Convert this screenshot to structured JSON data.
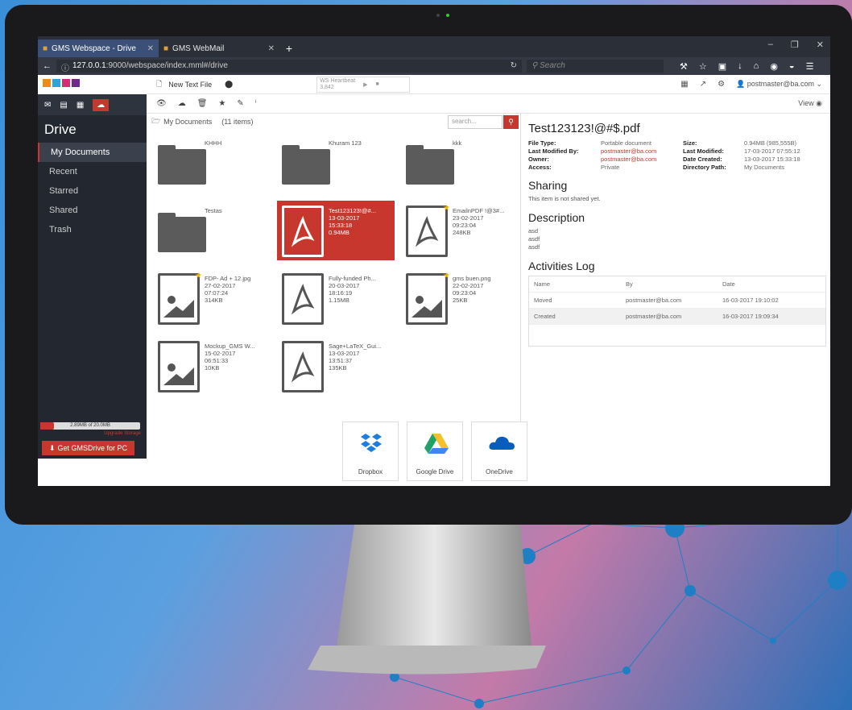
{
  "browser": {
    "tabs": [
      {
        "label": "GMS Webspace - Drive",
        "active": true
      },
      {
        "label": "GMS WebMail",
        "active": false
      }
    ],
    "url_host": "127.0.0.1",
    "url_rest": ":9000/webspace/index.mml#/drive",
    "search_placeholder": "Search"
  },
  "app": {
    "new_text_file": "New Text File",
    "heartbeat_label": "WS Heartbeat",
    "heartbeat_value": "3,842",
    "user": "postmaster@ba.com",
    "view_label": "View"
  },
  "sidebar": {
    "title": "Drive",
    "items": [
      "My Documents",
      "Recent",
      "Starred",
      "Shared",
      "Trash"
    ],
    "storage_text": "2.89MB of 20.0MB",
    "storage_fraction": 0.14,
    "upgrade_label": "Upgrade Storage",
    "get_button": "Get GMSDrive for PC"
  },
  "files": {
    "breadcrumb": "My Documents",
    "count": "(11 items)",
    "search_placeholder": "search...",
    "items": [
      {
        "name": "KHHH",
        "kind": "folder"
      },
      {
        "name": "Khuram 123",
        "kind": "folder"
      },
      {
        "name": "kkk",
        "kind": "folder"
      },
      {
        "name": "Testas",
        "kind": "folder"
      },
      {
        "name": "Test123123!@#...\n13-03-2017\n15:33:18\n0.94MB",
        "kind": "pdf",
        "selected": true
      },
      {
        "name": "EmailnPDF !@3#...\n23-02-2017\n09:23:04\n248KB",
        "kind": "pdf",
        "starred": true
      },
      {
        "name": "FDP- Ad + 12.jpg\n27-02-2017\n07:07:24\n314KB",
        "kind": "image",
        "starred": true
      },
      {
        "name": "Fully-funded Ph...\n20-03-2017\n18:16:19\n1.15MB",
        "kind": "pdf"
      },
      {
        "name": "gms buen.png\n22-02-2017\n09:23:04\n25KB",
        "kind": "image",
        "starred": true
      },
      {
        "name": "Mockup_GMS W...\n15-02-2017\n06:51:33\n10KB",
        "kind": "image"
      },
      {
        "name": "Sage+LaTeX_Gui...\n13-03-2017\n13:51:37\n135KB",
        "kind": "pdf"
      }
    ]
  },
  "detail": {
    "title": "Test123123!@#$.pdf",
    "props": [
      [
        "File Type:",
        "Portable document",
        "Size:",
        "0.94MB (985,555B)"
      ],
      [
        "Last Modified By:",
        "postmaster@ba.com",
        "Last Modified:",
        "17-03-2017 07:55:12"
      ],
      [
        "Owner:",
        "postmaster@ba.com",
        "Date Created:",
        "13-03-2017 15:33:18"
      ],
      [
        "Access:",
        "Private",
        "Directory Path:",
        "My Documents"
      ]
    ],
    "sharing_title": "Sharing",
    "sharing_text": "This item is not shared yet.",
    "description_title": "Description",
    "description_lines": [
      "asd",
      "asdf",
      "asdf"
    ],
    "log_title": "Activities Log",
    "log_headers": [
      "Name",
      "By",
      "Date"
    ],
    "log_rows": [
      [
        "Moved",
        "postmaster@ba.com",
        "16-03-2017 19:10:02"
      ],
      [
        "Created",
        "postmaster@ba.com",
        "16-03-2017 19:09:34"
      ]
    ]
  },
  "clouds": [
    "Dropbox",
    "Google Drive",
    "OneDrive"
  ],
  "colors": {
    "accent": "#c8372d",
    "sidebar": "#232830",
    "tab_active": "#3b5078"
  }
}
